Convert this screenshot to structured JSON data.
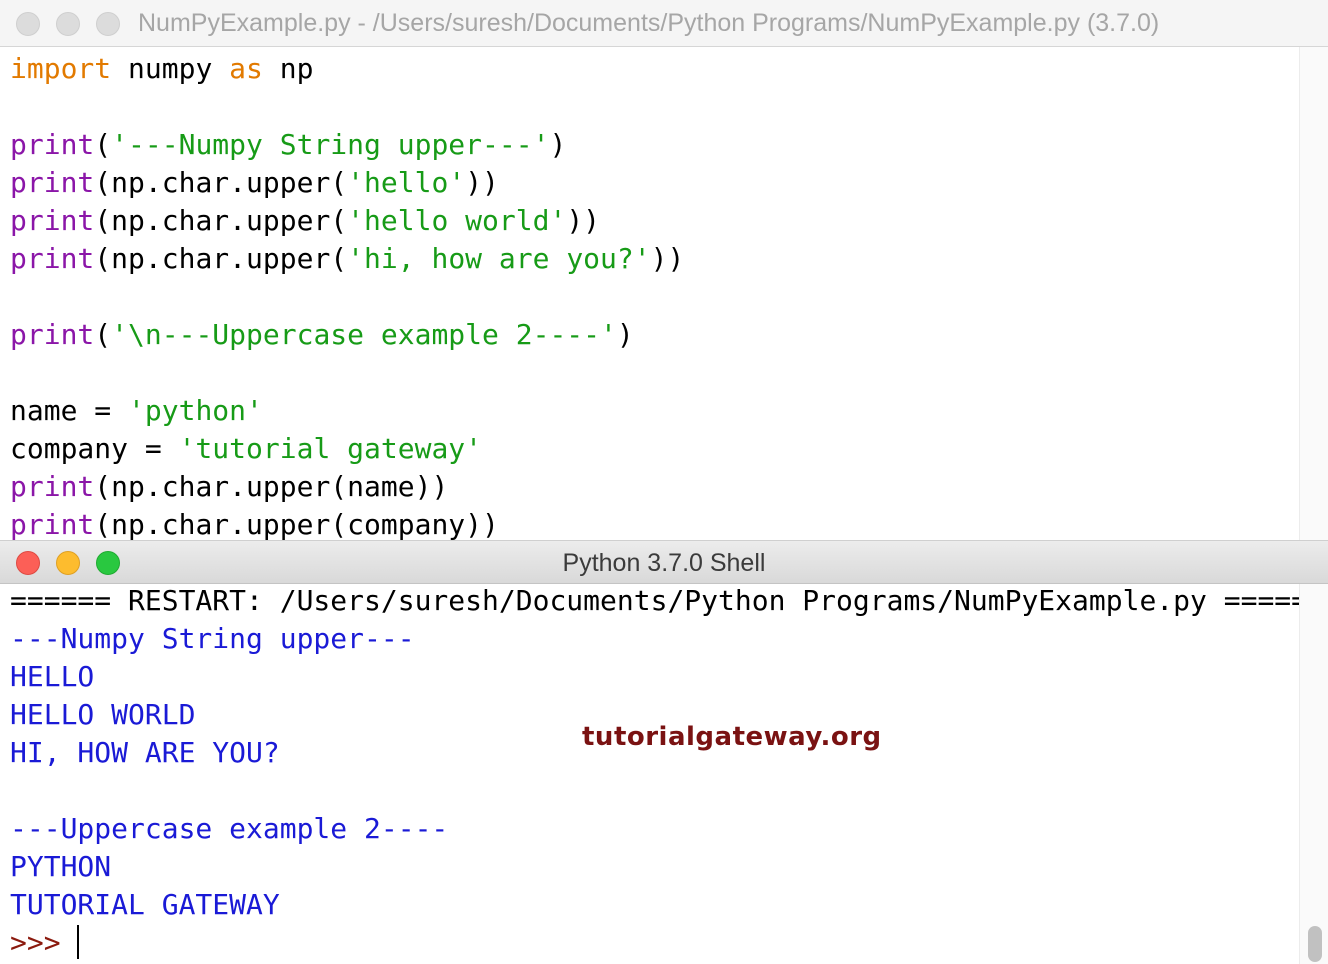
{
  "editor": {
    "title": "NumPyExample.py - /Users/suresh/Documents/Python Programs/NumPyExample.py (3.7.0)",
    "lines": {
      "l1": {
        "kw1": "import",
        "t1": " numpy ",
        "kw2": "as",
        "t2": " np"
      },
      "l2": {
        "fn": "print",
        "open": "(",
        "str": "'---Numpy String upper---'",
        "close": ")"
      },
      "l3": {
        "fn": "print",
        "pre": "(np.char.upper(",
        "str": "'hello'",
        "close": "))"
      },
      "l4": {
        "fn": "print",
        "pre": "(np.char.upper(",
        "str": "'hello world'",
        "close": "))"
      },
      "l5": {
        "fn": "print",
        "pre": "(np.char.upper(",
        "str": "'hi, how are you?'",
        "close": "))"
      },
      "l6": {
        "fn": "print",
        "open": "(",
        "str": "'\\n---Uppercase example 2----'",
        "close": ")"
      },
      "l7": {
        "pre": "name = ",
        "str": "'python'"
      },
      "l8": {
        "pre": "company = ",
        "str": "'tutorial gateway'"
      },
      "l9": {
        "fn": "print",
        "rest": "(np.char.upper(name))"
      },
      "l10": {
        "fn": "print",
        "rest": "(np.char.upper(company))"
      }
    }
  },
  "shell": {
    "title": "Python 3.7.0 Shell",
    "restart_line": "====== RESTART: /Users/suresh/Documents/Python Programs/NumPyExample.py ======",
    "output": [
      "---Numpy String upper---",
      "HELLO",
      "HELLO WORLD",
      "HI, HOW ARE YOU?",
      "",
      "---Uppercase example 2----",
      "PYTHON",
      "TUTORIAL GATEWAY"
    ],
    "prompt": ">>>",
    "watermark": "tutorialgateway.org"
  },
  "colors": {
    "keyword": "#e27a00",
    "builtin": "#8b16a8",
    "string": "#179b17",
    "output": "#1a1ad6",
    "prompt": "#8b1a0e",
    "watermark": "#7a1212"
  }
}
